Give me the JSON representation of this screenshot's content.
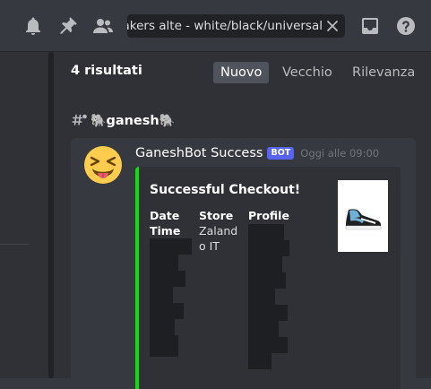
{
  "toolbar": {
    "icons": [
      "bell-icon",
      "pin-icon",
      "members-icon",
      "inbox-icon",
      "help-icon"
    ],
    "search": {
      "value": "Sneakers alte - white/black/universal",
      "clear_icon": "close-icon"
    }
  },
  "results": {
    "count_label": "4 risultati",
    "sort_tabs": [
      {
        "label": "Nuovo",
        "active": true
      },
      {
        "label": "Vecchio",
        "active": false
      },
      {
        "label": "Rilevanza",
        "active": false
      }
    ],
    "channel": {
      "icon": "text-channel-thread-icon",
      "prefix_emoji": "🐘",
      "name": "ganesh",
      "suffix_emoji": "🐘"
    },
    "message": {
      "avatar": "squinting-face-with-tongue-emoji",
      "username": "GaneshBot Success",
      "bot_tag": "BOT",
      "timestamp": "Oggi alle 09:00",
      "embed": {
        "accent_color": "#0ae00a",
        "title": "Successful Checkout!",
        "thumbnail": "sneaker-image",
        "fields": [
          {
            "name": "Date\nTime",
            "value": ""
          },
          {
            "name": "Store",
            "value": "Zaland\no IT"
          },
          {
            "name": "Profile",
            "value": ""
          }
        ]
      }
    }
  },
  "colors": {
    "background": "#36393f",
    "panel": "#2f3136",
    "accent": "#5865f2",
    "embed_bar": "#0ae00a"
  }
}
